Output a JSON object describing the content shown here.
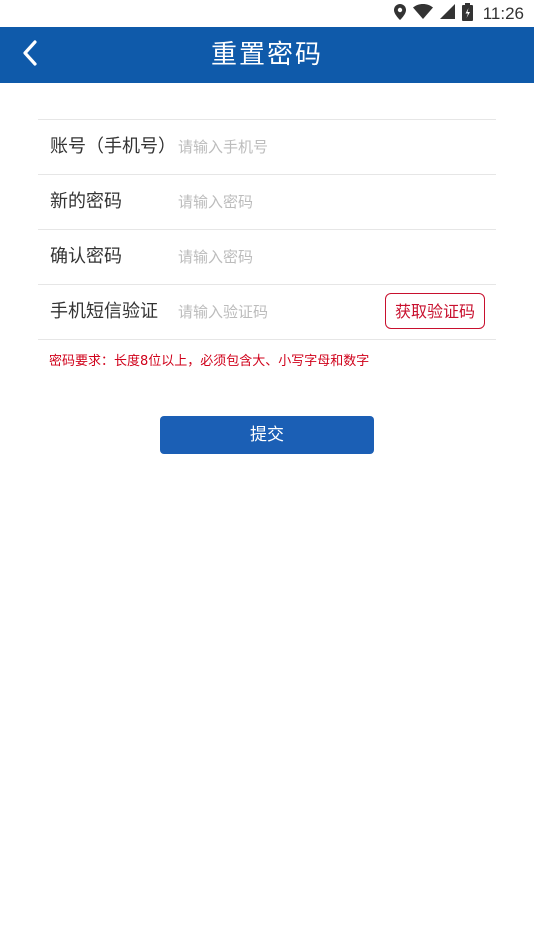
{
  "status_bar": {
    "time": "11:26",
    "icons": [
      "location-icon",
      "wifi-icon",
      "signal-icon",
      "battery-icon"
    ]
  },
  "header": {
    "title": "重置密码",
    "back_icon": "chevron-left-icon",
    "background_color": "#0f5aaa"
  },
  "form": {
    "fields": [
      {
        "label": "账号（手机号）",
        "placeholder": "请输入手机号",
        "value": ""
      },
      {
        "label": "新的密码",
        "placeholder": "请输入密码",
        "value": ""
      },
      {
        "label": "确认密码",
        "placeholder": "请输入密码",
        "value": ""
      },
      {
        "label": "手机短信验证",
        "placeholder": "请输入验证码",
        "value": ""
      }
    ],
    "get_code_label": "获取验证码",
    "password_hint": "密码要求：长度8位以上，必须包含大、小写字母和数字",
    "hint_color": "#d0021b"
  },
  "actions": {
    "submit_label": "提交",
    "submit_color": "#1b5fb5"
  }
}
